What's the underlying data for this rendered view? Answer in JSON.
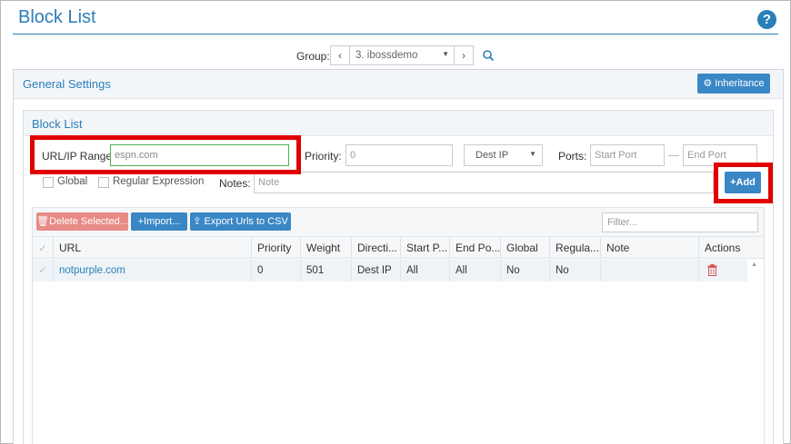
{
  "page": {
    "title": "Block List"
  },
  "icons": {
    "help": "help-icon",
    "search": "search-icon",
    "gear": "gear-icon",
    "trash": "trash-icon",
    "upload": "upload-icon",
    "plus": "plus-icon"
  },
  "group": {
    "label": "Group:",
    "prev": "‹",
    "next": "›",
    "selected": "3. ibossdemo"
  },
  "general_settings": {
    "title": "General Settings",
    "inheritance_label": "Inheritance"
  },
  "block_list": {
    "title": "Block List",
    "url_label": "URL/IP Range:",
    "url_value": "espn.com",
    "priority_label": "Priority:",
    "priority_placeholder": "0",
    "direction_selected": "Dest IP",
    "ports_label": "Ports:",
    "start_port_placeholder": "Start Port",
    "end_port_placeholder": "End Port",
    "global_label": "Global",
    "regex_label": "Regular Expression",
    "notes_label": "Notes:",
    "notes_placeholder": "Note",
    "add_label": "Add"
  },
  "toolbar": {
    "delete_label": "Delete Selected...",
    "import_label": "Import...",
    "export_label": "Export Urls to CSV",
    "filter_placeholder": "Filter..."
  },
  "table": {
    "columns": [
      "URL",
      "Priority",
      "Weight",
      "Directi...",
      "Start P...",
      "End Po...",
      "Global",
      "Regula...",
      "Note",
      "Actions"
    ],
    "rows": [
      {
        "url": "notpurple.com",
        "priority": "0",
        "weight": "501",
        "direction": "Dest IP",
        "start_port": "All",
        "end_port": "All",
        "global": "No",
        "regex": "No",
        "note": ""
      }
    ]
  },
  "colors": {
    "accent": "#2a7fb8",
    "button": "#3a87c6",
    "delete": "#e88a85",
    "highlight": "#e00000",
    "trash": "#d9534f"
  }
}
